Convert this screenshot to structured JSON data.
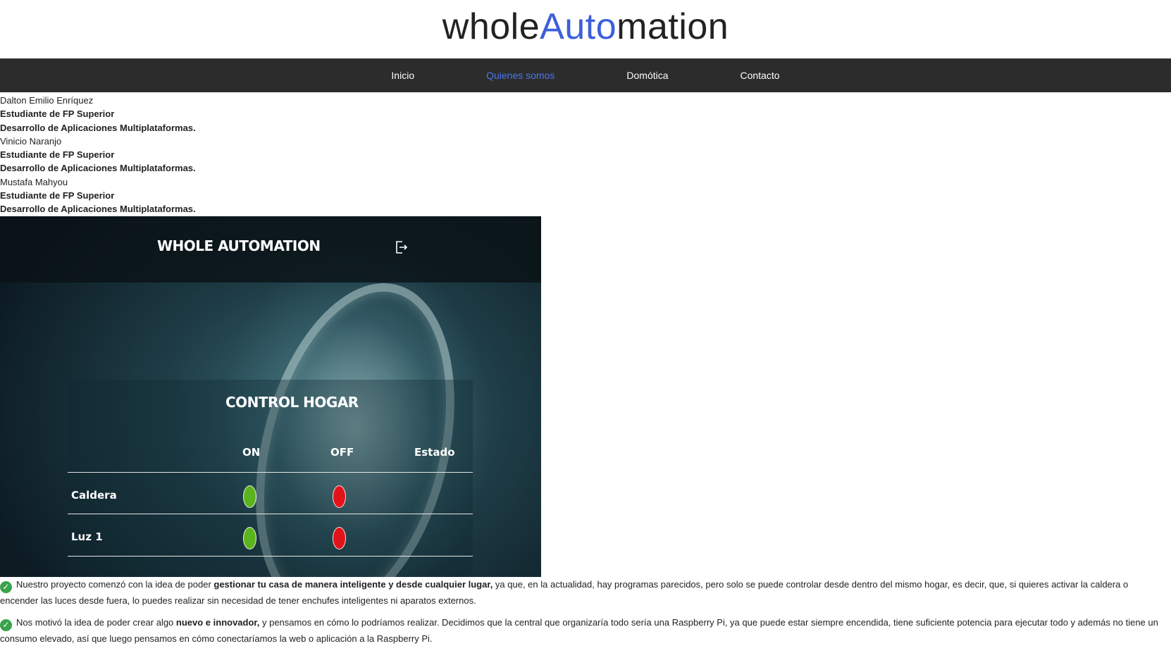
{
  "logo": {
    "part1": "whole",
    "accent": "Auto",
    "part2": "mation"
  },
  "nav": [
    {
      "label": "Inicio"
    },
    {
      "label": "Quienes somos"
    },
    {
      "label": "Domótica"
    },
    {
      "label": "Contacto"
    }
  ],
  "team": [
    {
      "name": "Dalton Emilio Enríquez",
      "line1": "Estudiante de FP Superior",
      "line2": "Desarrollo de Aplicaciones Multiplataformas."
    },
    {
      "name": "Vinicio Naranjo",
      "line1": "Estudiante de FP Superior",
      "line2": "Desarrollo de Aplicaciones Multiplataformas."
    },
    {
      "name": "Mustafa Mahyou",
      "line1": "Estudiante de FP Superior",
      "line2": "Desarrollo de Aplicaciones Multiplataformas."
    }
  ],
  "app_screenshot": {
    "title": "WHOLE AUTOMATION",
    "panel_title": "CONTROL HOGAR",
    "columns": [
      "ON",
      "OFF",
      "Estado"
    ],
    "rows": [
      {
        "label": "Caldera"
      },
      {
        "label": "Luz 1"
      }
    ],
    "colors": {
      "on": "#5bb31e",
      "off": "#e3131b"
    },
    "icon": "logout-icon"
  },
  "paragraphs": [
    {
      "pre": "Nuestro proyecto comenzó con la idea de poder ",
      "bold": "gestionar tu casa de manera inteligente y desde cualquier lugar,",
      "post": " ya que, en la actualidad, hay programas parecidos, pero solo se puede controlar desde dentro del mismo hogar, es decir, que, si quieres activar la caldera o encender las luces desde fuera, lo puedes realizar sin necesidad de tener enchufes inteligentes ni aparatos externos."
    },
    {
      "pre": "Nos motivó la idea de poder crear algo ",
      "bold": "nuevo e innovador,",
      "post": " y pensamos en cómo lo podríamos realizar. Decidimos que la central que organizaría todo sería una Raspberry Pi, ya que puede estar siempre encendida, tiene suficiente potencia para ejecutar todo y además no tiene un consumo elevado, así que luego pensamos en cómo conectaríamos la web o aplicación a la Raspberry Pi."
    }
  ],
  "colors": {
    "accent": "#3d5fd9",
    "nav_bg": "#2c2c2c",
    "nav_active": "#4a78e8",
    "check": "#3aa34b"
  }
}
